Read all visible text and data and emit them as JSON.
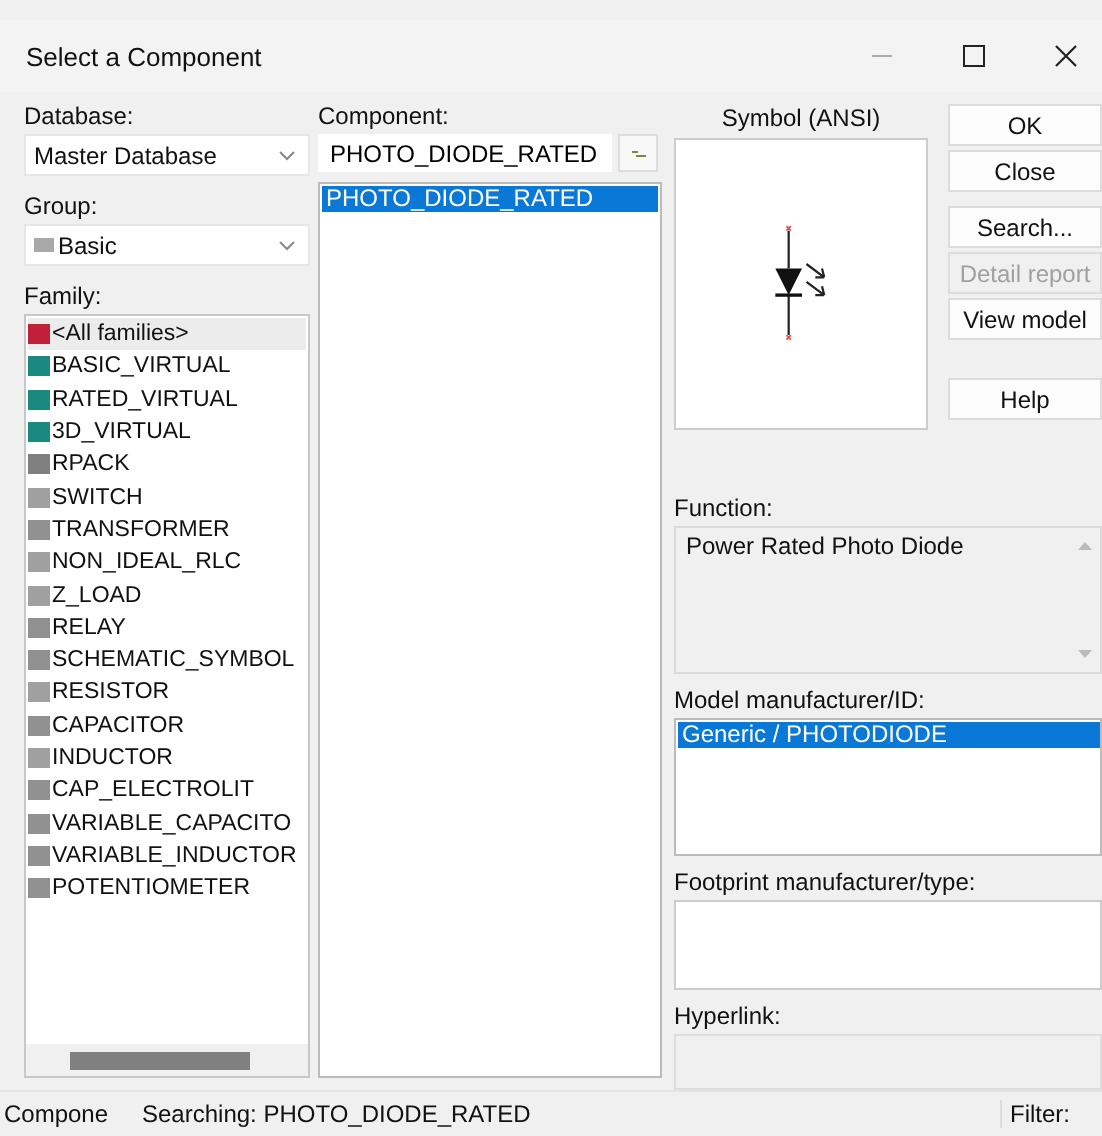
{
  "window": {
    "title": "Select a Component"
  },
  "database": {
    "label": "Database:",
    "value": "Master Database"
  },
  "group": {
    "label": "Group:",
    "value": "Basic"
  },
  "family": {
    "label": "Family:",
    "items": [
      {
        "label": "<All families>",
        "selected": true,
        "color": "#c0203a"
      },
      {
        "label": "BASIC_VIRTUAL",
        "selected": false,
        "color": "#1a8a80"
      },
      {
        "label": "RATED_VIRTUAL",
        "selected": false,
        "color": "#1a8a80"
      },
      {
        "label": "3D_VIRTUAL",
        "selected": false,
        "color": "#1a8a80"
      },
      {
        "label": "RPACK",
        "selected": false,
        "color": "#808080"
      },
      {
        "label": "SWITCH",
        "selected": false,
        "color": "#a0a0a0"
      },
      {
        "label": "TRANSFORMER",
        "selected": false,
        "color": "#909090"
      },
      {
        "label": "NON_IDEAL_RLC",
        "selected": false,
        "color": "#a0a0a0"
      },
      {
        "label": "Z_LOAD",
        "selected": false,
        "color": "#a0a0a0"
      },
      {
        "label": "RELAY",
        "selected": false,
        "color": "#909090"
      },
      {
        "label": "SCHEMATIC_SYMBOL",
        "selected": false,
        "color": "#909090"
      },
      {
        "label": "RESISTOR",
        "selected": false,
        "color": "#a0a0a0"
      },
      {
        "label": "CAPACITOR",
        "selected": false,
        "color": "#909090"
      },
      {
        "label": "INDUCTOR",
        "selected": false,
        "color": "#a0a0a0"
      },
      {
        "label": "CAP_ELECTROLIT",
        "selected": false,
        "color": "#909090"
      },
      {
        "label": "VARIABLE_CAPACITO",
        "selected": false,
        "color": "#909090"
      },
      {
        "label": "VARIABLE_INDUCTOR",
        "selected": false,
        "color": "#909090"
      },
      {
        "label": "POTENTIOMETER",
        "selected": false,
        "color": "#909090"
      }
    ]
  },
  "component": {
    "label": "Component:",
    "value": "PHOTO_DIODE_RATED",
    "items": [
      {
        "label": "PHOTO_DIODE_RATED",
        "selected": true
      }
    ]
  },
  "symbol": {
    "label": "Symbol (ANSI)"
  },
  "button_groups": [
    [
      {
        "label": "OK",
        "disabled": false
      },
      {
        "label": "Close",
        "disabled": false
      }
    ],
    [
      {
        "label": "Search...",
        "disabled": false
      },
      {
        "label": "Detail report",
        "disabled": true
      },
      {
        "label": "View model",
        "disabled": false
      }
    ],
    [
      {
        "label": "Help",
        "disabled": false
      }
    ]
  ],
  "function": {
    "label": "Function:",
    "value": "Power Rated Photo Diode"
  },
  "model": {
    "label": "Model manufacturer/ID:",
    "items": [
      {
        "label": "Generic / PHOTODIODE",
        "selected": true
      }
    ]
  },
  "footprint": {
    "label": "Footprint manufacturer/type:"
  },
  "hyperlink": {
    "label": "Hyperlink:"
  },
  "status_bar": [
    "Compone",
    "Searching: PHOTO_DIODE_RATED",
    "Filter:"
  ]
}
